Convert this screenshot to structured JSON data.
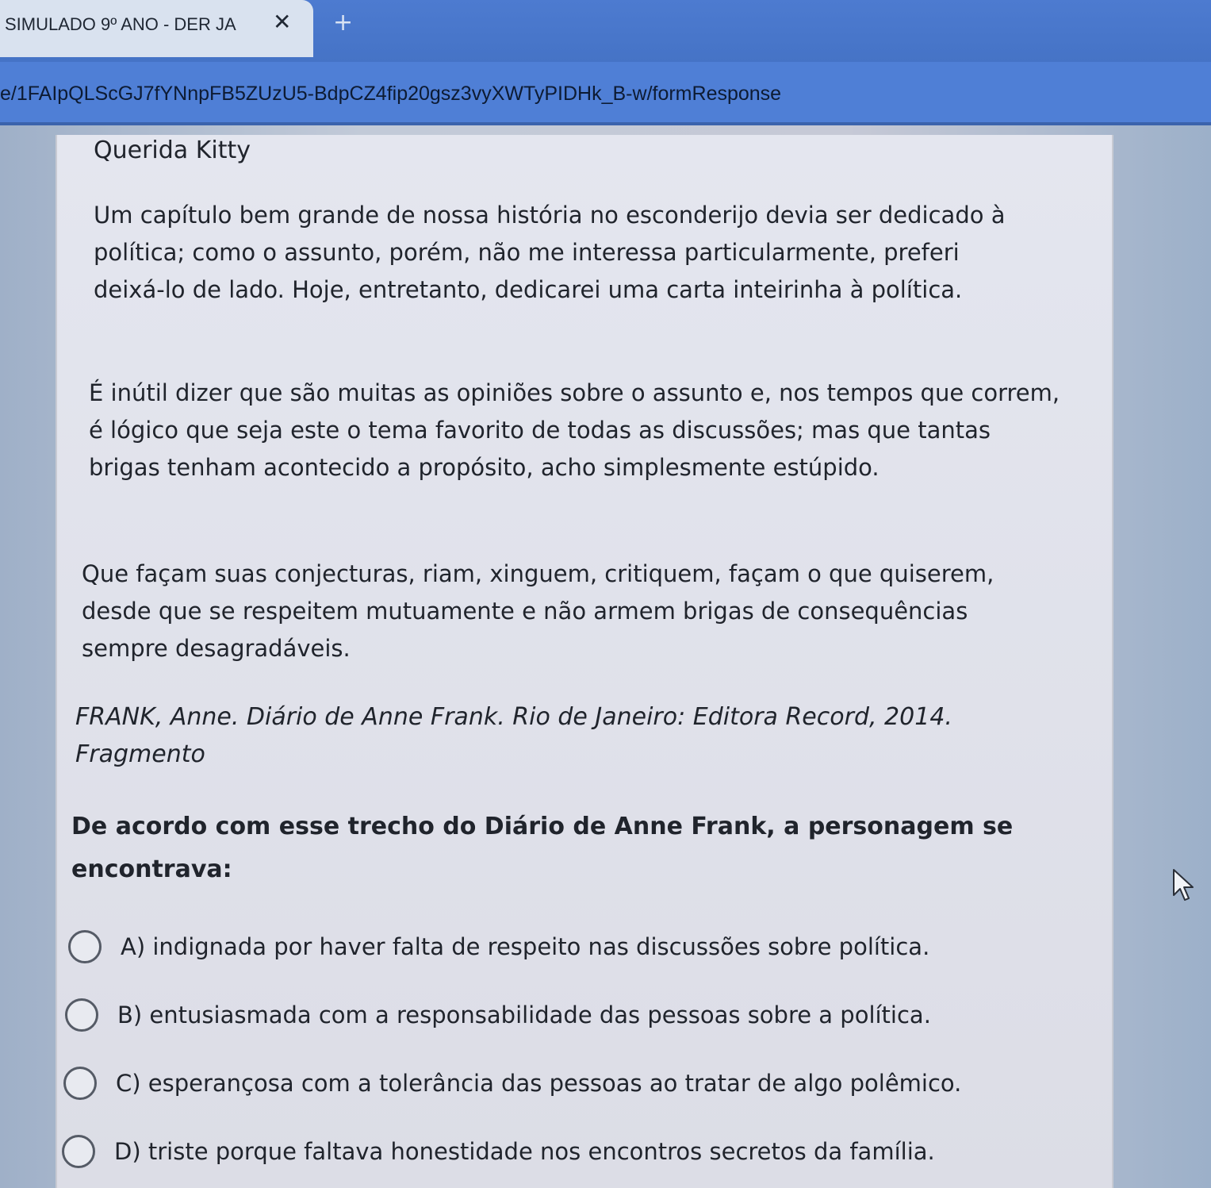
{
  "browser": {
    "tab_title": "SIMULADO 9º ANO - DER JA",
    "tab_close": "✕",
    "new_tab": "+",
    "url": "e/1FAIpQLScGJ7fYNnpFB5ZUzU5-BdpCZ4fip20gsz3vyXWTyPIDHk_B-w/formResponse"
  },
  "form": {
    "greeting": "Querida Kitty",
    "paragraphs": [
      "Um capítulo bem grande de nossa história no esconderijo devia ser dedicado à política; como o assunto, porém, não me interessa particularmente, preferi deixá-lo de lado. Hoje, entretanto, dedicarei uma carta inteirinha à política.",
      "É inútil dizer que são muitas as opiniões sobre o assunto e, nos tempos que correm, é lógico que seja este o tema favorito de todas as discussões; mas que tantas brigas tenham acontecido a propósito, acho simplesmente estúpido.",
      "Que façam suas conjecturas, riam, xinguem, critiquem, façam o que quiserem, desde que se respeitem mutuamente e não armem brigas de consequências sempre desagradáveis."
    ],
    "citation": "FRANK, Anne. Diário de Anne Frank. Rio de Janeiro: Editora Record, 2014. Fragmento",
    "question": "De acordo com esse trecho do Diário de Anne Frank, a personagem se encontrava:",
    "options": [
      "A) indignada por haver falta de respeito nas discussões sobre política.",
      "B) entusiasmada com a responsabilidade das pessoas sobre a política.",
      "C) esperançosa com a tolerância das pessoas ao tratar de algo polêmico.",
      "D) triste porque faltava honestidade nos encontros secretos da família."
    ]
  },
  "colors": {
    "tabbar": "#4573c6",
    "urlbar": "#4f7fd6",
    "card": "#e0e2eb",
    "text": "#20242c"
  }
}
